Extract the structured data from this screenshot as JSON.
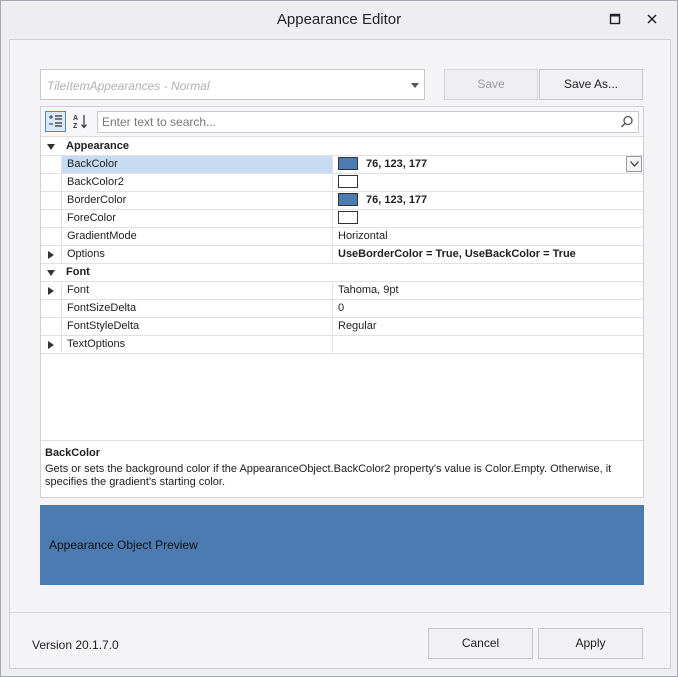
{
  "window": {
    "title": "Appearance Editor"
  },
  "toolbar": {
    "appearance_selector_value": "TileItemAppearances - Normal",
    "save_label": "Save",
    "save_as_label": "Save As..."
  },
  "grid": {
    "search_placeholder": "Enter text to search...",
    "categories": {
      "appearance": "Appearance",
      "font": "Font"
    },
    "rows": {
      "backcolor": {
        "name": "BackColor",
        "value": "76, 123, 177",
        "swatch": "#4c7bb1"
      },
      "backcolor2": {
        "name": "BackColor2",
        "value": "",
        "swatch": "#ffffff"
      },
      "bordercolor": {
        "name": "BorderColor",
        "value": "76, 123, 177",
        "swatch": "#4c7bb1"
      },
      "forecolor": {
        "name": "ForeColor",
        "value": "",
        "swatch": "#ffffff"
      },
      "gradientmode": {
        "name": "GradientMode",
        "value": "Horizontal"
      },
      "options": {
        "name": "Options",
        "value": "UseBorderColor = True, UseBackColor = True"
      },
      "font": {
        "name": "Font",
        "value": "Tahoma, 9pt"
      },
      "fontsizedelta": {
        "name": "FontSizeDelta",
        "value": "0"
      },
      "fontstyledelta": {
        "name": "FontStyleDelta",
        "value": "Regular"
      },
      "textoptions": {
        "name": "TextOptions",
        "value": ""
      }
    },
    "description": {
      "title": "BackColor",
      "text": "Gets or sets the background color if the AppearanceObject.BackColor2 property's value is Color.Empty. Otherwise, it specifies the gradient's starting color."
    }
  },
  "preview": {
    "text": "Appearance Object Preview",
    "color": "#4c7bb1"
  },
  "footer": {
    "version": "Version 20.1.7.0",
    "cancel_label": "Cancel",
    "apply_label": "Apply"
  },
  "colors": {
    "accent": "#4f86c6",
    "selection": "#c7dbf2"
  }
}
